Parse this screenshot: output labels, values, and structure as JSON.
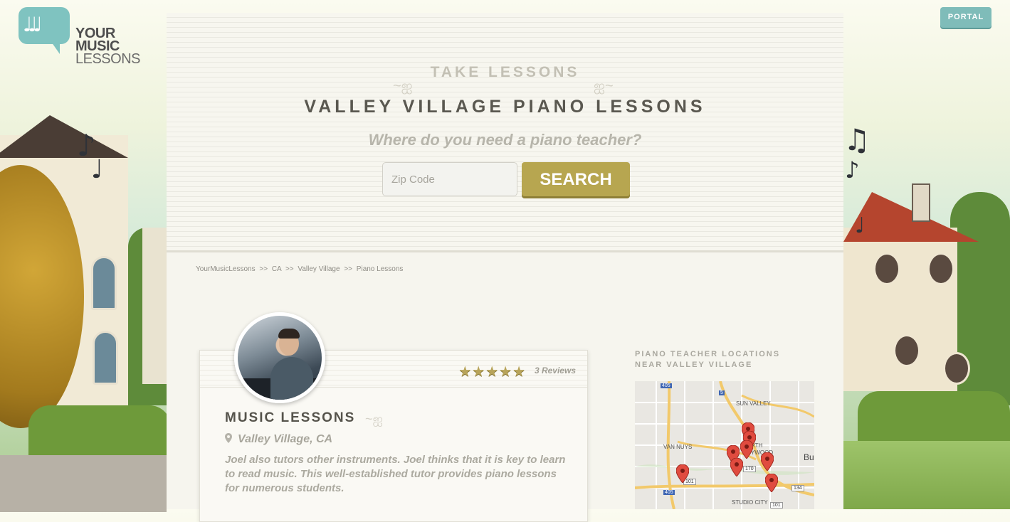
{
  "logo": {
    "line1": "YOUR",
    "line2": "MUSIC",
    "line3": "LESSONS",
    "notes_icon": "music-notes-icon"
  },
  "header": {
    "portal_label": "PORTAL"
  },
  "hero": {
    "eyebrow": "TAKE LESSONS",
    "title": "VALLEY VILLAGE PIANO LESSONS",
    "prompt": "Where do you need a piano teacher?",
    "zip_placeholder": "Zip Code",
    "zip_value": "",
    "search_label": "SEARCH"
  },
  "breadcrumb": {
    "items": [
      "YourMusicLessons",
      "CA",
      "Valley Village",
      "Piano Lessons"
    ],
    "separator": ">>"
  },
  "card": {
    "title": "MUSIC LESSONS",
    "location": "Valley Village, CA",
    "stars": "★★★★★",
    "rating": 5,
    "reviews": "3 Reviews",
    "description": "Joel also tutors other instruments. Joel thinks that it is key to learn to read music. This well-established tutor provides piano lessons for numerous students."
  },
  "map": {
    "heading_line1": "PIANO TEACHER LOCATIONS",
    "heading_line2": "NEAR VALLEY VILLAGE",
    "labels": [
      "SUN VALLEY",
      "VAN NUYS",
      "RTH",
      "YWOOD",
      "Bu",
      "STUDIO CITY",
      "405",
      "5",
      "170",
      "134",
      "405",
      "101",
      "101"
    ]
  },
  "colors": {
    "accent": "#b7a650",
    "portal": "#7fbcb9",
    "panel": "#f7f6ef",
    "pin": "#e04b3f"
  }
}
